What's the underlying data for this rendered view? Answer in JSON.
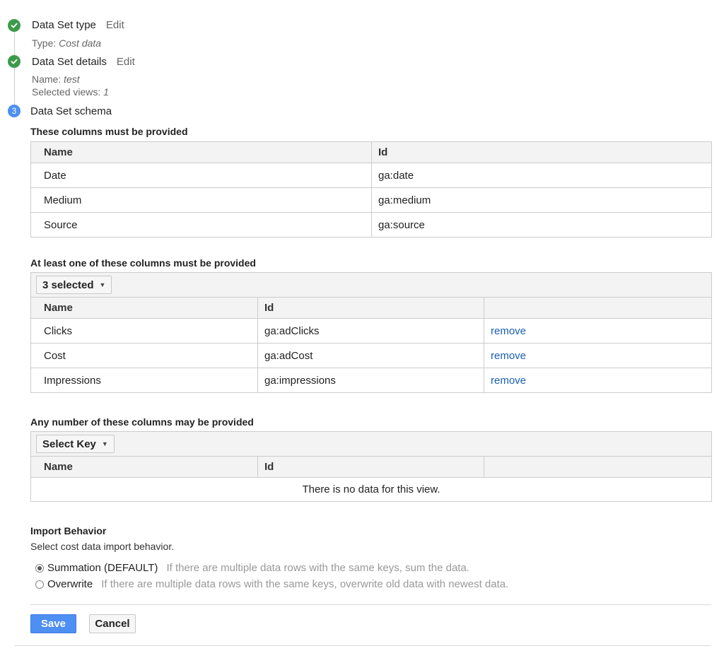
{
  "steps": [
    {
      "status": "done",
      "title": "Data Set type",
      "edit_label": "Edit",
      "sub": [
        {
          "label": "Type: ",
          "value": "Cost data"
        }
      ]
    },
    {
      "status": "done",
      "title": "Data Set details",
      "edit_label": "Edit",
      "sub": [
        {
          "label": "Name: ",
          "value": "test"
        },
        {
          "label": "Selected views: ",
          "value": "1"
        }
      ]
    },
    {
      "status": "current",
      "number": "3",
      "title": "Data Set schema"
    }
  ],
  "required": {
    "title": "These columns must be provided",
    "headers": [
      "Name",
      "Id"
    ],
    "rows": [
      [
        "Date",
        "ga:date"
      ],
      [
        "Medium",
        "ga:medium"
      ],
      [
        "Source",
        "ga:source"
      ]
    ]
  },
  "at_least_one": {
    "title": "At least one of these columns must be provided",
    "dropdown_label": "3 selected",
    "headers": [
      "Name",
      "Id",
      ""
    ],
    "rows": [
      [
        "Clicks",
        "ga:adClicks",
        "remove"
      ],
      [
        "Cost",
        "ga:adCost",
        "remove"
      ],
      [
        "Impressions",
        "ga:impressions",
        "remove"
      ]
    ]
  },
  "any_number": {
    "title": "Any number of these columns may be provided",
    "dropdown_label": "Select Key",
    "headers": [
      "Name",
      "Id",
      ""
    ],
    "empty_text": "There is no data for this view."
  },
  "import_behavior": {
    "title": "Import Behavior",
    "subtitle": "Select cost data import behavior.",
    "options": [
      {
        "label": "Summation (DEFAULT)",
        "desc": "If there are multiple data rows with the same keys, sum the data.",
        "selected": true
      },
      {
        "label": "Overwrite",
        "desc": "If there are multiple data rows with the same keys, overwrite old data with newest data.",
        "selected": false
      }
    ]
  },
  "actions": {
    "save_label": "Save",
    "cancel_label": "Cancel"
  },
  "colors": {
    "done": "#3c9b49",
    "current": "#4d8ff2",
    "link": "#1a5fb4",
    "primary": "#4d8ff2"
  }
}
